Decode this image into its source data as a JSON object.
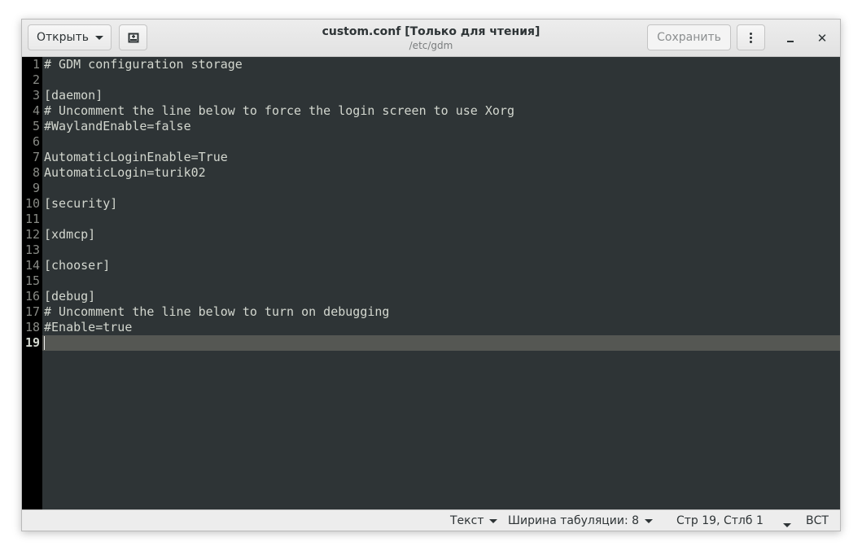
{
  "window": {
    "title": "custom.conf [Только для чтения]",
    "subtitle": "/etc/gdm"
  },
  "toolbar": {
    "open_label": "Открыть",
    "save_label": "Сохранить"
  },
  "editor": {
    "line_numbers": [
      "1",
      "2",
      "3",
      "4",
      "5",
      "6",
      "7",
      "8",
      "9",
      "10",
      "11",
      "12",
      "13",
      "14",
      "15",
      "16",
      "17",
      "18",
      "19"
    ],
    "current_line": "19",
    "lines": [
      "# GDM configuration storage",
      "",
      "[daemon]",
      "# Uncomment the line below to force the login screen to use Xorg",
      "#WaylandEnable=false",
      "",
      "AutomaticLoginEnable=True",
      "AutomaticLogin=turik02",
      "",
      "[security]",
      "",
      "[xdmcp]",
      "",
      "[chooser]",
      "",
      "[debug]",
      "# Uncomment the line below to turn on debugging",
      "#Enable=true",
      ""
    ]
  },
  "statusbar": {
    "language": "Текст",
    "tab_width": "Ширина табуляции: 8",
    "position": "Стр 19, Стлб 1",
    "insert_mode": "ВСТ"
  },
  "colors": {
    "editor_bg": "#2e3436",
    "gutter_bg": "#000000",
    "current_line_bg": "#555753",
    "text": "#d3d7cf"
  }
}
